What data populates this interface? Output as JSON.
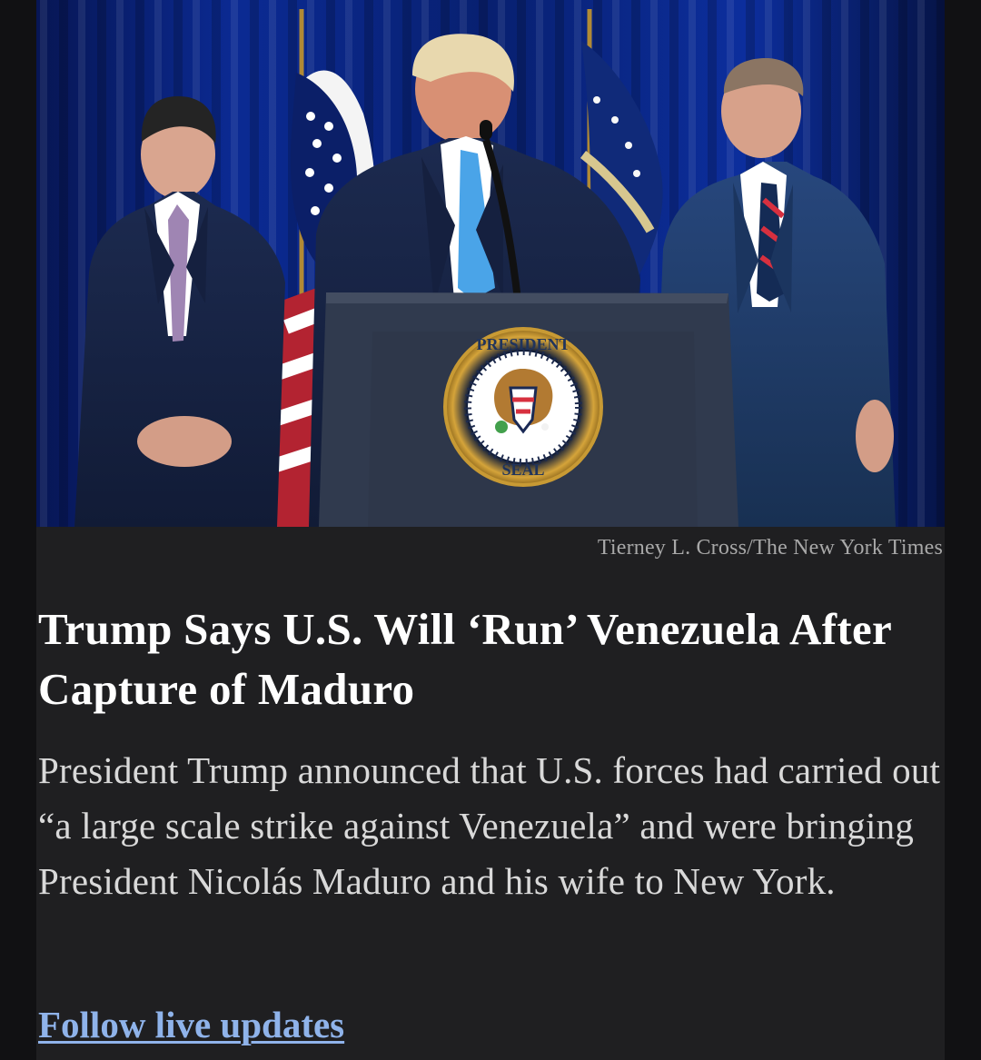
{
  "article": {
    "photo_credit": "Tierney L. Cross/The New York Times",
    "headline": "Trump Says U.S. Will ‘Run’ Venezuela After Capture of Maduro",
    "summary": "President Trump announced that U.S. forces had carried out “a large scale strike against Venezuela” and were bringing President Nicolás Maduro and his wife to New York.",
    "follow_link_label": "Follow live updates",
    "podium_seal_text": "SEAL OF THE PRESIDENT OF THE UNITED STATES"
  },
  "colors": {
    "page_background": "#111113",
    "card_background": "#1f1f21",
    "headline_text": "#ffffff",
    "summary_text": "#d9d9d9",
    "credit_text": "#a8a8a8",
    "link": "#8fb3ea",
    "curtain": "#0a1f73"
  }
}
